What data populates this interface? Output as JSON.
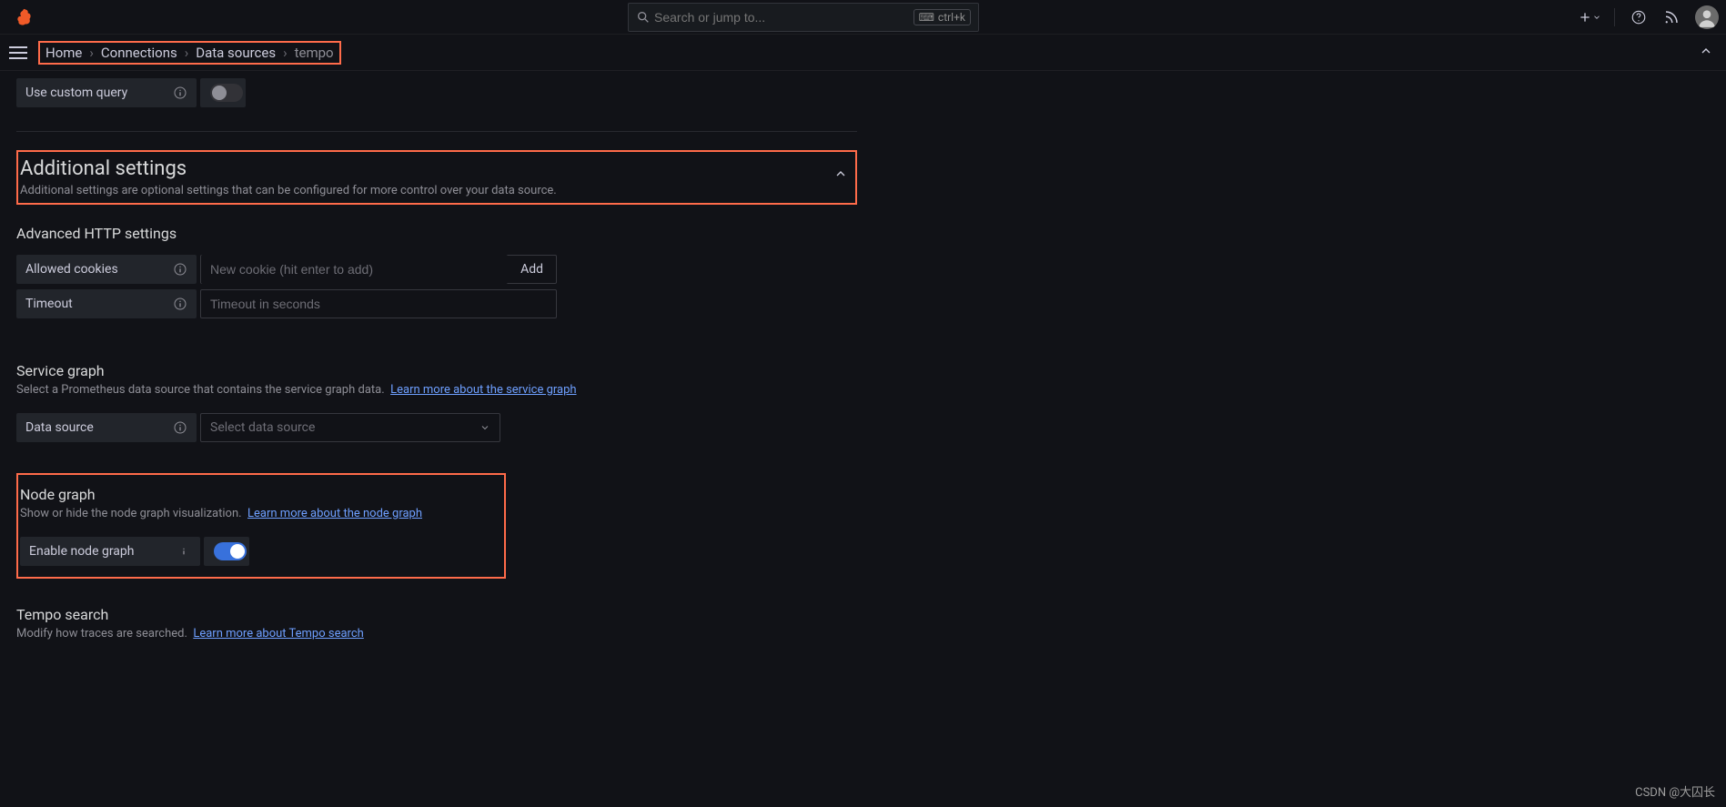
{
  "search": {
    "placeholder": "Search or jump to...",
    "kbd": "ctrl+k"
  },
  "breadcrumb": {
    "home": "Home",
    "connections": "Connections",
    "datasources": "Data sources",
    "current": "tempo"
  },
  "custom_query": {
    "label": "Use custom query"
  },
  "additional": {
    "title": "Additional settings",
    "desc": "Additional settings are optional settings that can be configured for more control over your data source."
  },
  "advanced_http": "Advanced HTTP settings",
  "allowed_cookies": {
    "label": "Allowed cookies",
    "placeholder": "New cookie (hit enter to add)",
    "add": "Add"
  },
  "timeout": {
    "label": "Timeout",
    "placeholder": "Timeout in seconds"
  },
  "service_graph": {
    "title": "Service graph",
    "desc": "Select a Prometheus data source that contains the service graph data.",
    "link": "Learn more about the service graph",
    "ds_label": "Data source",
    "select_placeholder": "Select data source"
  },
  "node_graph": {
    "title": "Node graph",
    "desc": "Show or hide the node graph visualization.",
    "link": "Learn more about the node graph",
    "enable_label": "Enable node graph"
  },
  "tempo_search": {
    "title": "Tempo search",
    "desc": "Modify how traces are searched.",
    "link": "Learn more about Tempo search"
  },
  "watermark": "CSDN @大囚长"
}
